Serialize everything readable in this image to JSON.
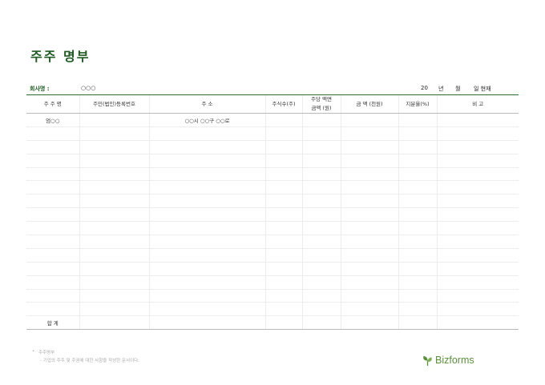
{
  "title": "주주 명부",
  "company": {
    "label": "회사명 :",
    "value": "○○○"
  },
  "date": {
    "year": "20",
    "year_unit": "년",
    "month_unit": "월",
    "day_suffix": "일 현재"
  },
  "table": {
    "headers": [
      {
        "line1": "주 주 명",
        "line2": ""
      },
      {
        "line1": "주민(법인)등록번호",
        "line2": ""
      },
      {
        "line1": "주          소",
        "line2": ""
      },
      {
        "line1": "주식수(주)",
        "line2": ""
      },
      {
        "line1": "주당 액면",
        "line2": "금액 (원)"
      },
      {
        "line1": "금  액 (천원)",
        "line2": ""
      },
      {
        "line1": "지분율(%)",
        "line2": ""
      },
      {
        "line1": "비      고",
        "line2": ""
      }
    ],
    "rows": [
      [
        "엄○○",
        "",
        "○○시 ○○구 ○○로",
        "",
        "",
        "",
        "",
        ""
      ],
      [
        "",
        "",
        "",
        "",
        "",
        "",
        "",
        ""
      ],
      [
        "",
        "",
        "",
        "",
        "",
        "",
        "",
        ""
      ],
      [
        "",
        "",
        "",
        "",
        "",
        "",
        "",
        ""
      ],
      [
        "",
        "",
        "",
        "",
        "",
        "",
        "",
        ""
      ],
      [
        "",
        "",
        "",
        "",
        "",
        "",
        "",
        ""
      ],
      [
        "",
        "",
        "",
        "",
        "",
        "",
        "",
        ""
      ],
      [
        "",
        "",
        "",
        "",
        "",
        "",
        "",
        ""
      ],
      [
        "",
        "",
        "",
        "",
        "",
        "",
        "",
        ""
      ],
      [
        "",
        "",
        "",
        "",
        "",
        "",
        "",
        ""
      ],
      [
        "",
        "",
        "",
        "",
        "",
        "",
        "",
        ""
      ],
      [
        "",
        "",
        "",
        "",
        "",
        "",
        "",
        ""
      ],
      [
        "",
        "",
        "",
        "",
        "",
        "",
        "",
        ""
      ],
      [
        "",
        "",
        "",
        "",
        "",
        "",
        "",
        ""
      ],
      [
        "",
        "",
        "",
        "",
        "",
        "",
        "",
        ""
      ]
    ],
    "total_label": "합    계"
  },
  "footnote": {
    "bullet": "•",
    "line1": "주주명부",
    "line2": "- 기업의 주주 및 주권에 대한 사항을 작성한 문서이다."
  },
  "brand": {
    "name": "Bizforms",
    "color": "#5a8f3d",
    "icon": "leaf-logo-icon"
  }
}
